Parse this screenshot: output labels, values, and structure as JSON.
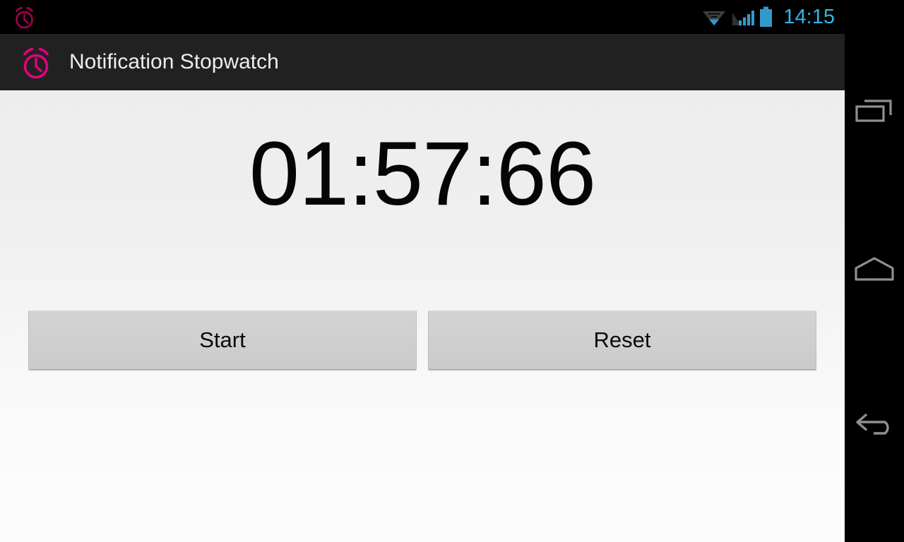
{
  "status_bar": {
    "alarm_icon": "alarm-clock-icon",
    "wifi_icon": "wifi-icon",
    "signal_icon": "cellular-signal-icon",
    "battery_icon": "battery-full-icon",
    "clock": "14:15",
    "accent_color": "#33b5e5",
    "background_color": "#000000"
  },
  "action_bar": {
    "app_icon": "alarm-clock-icon",
    "title": "Notification Stopwatch",
    "background_color": "#212121",
    "title_color": "#ededed",
    "icon_color": "#e6007e"
  },
  "main": {
    "timer": "01:57:66",
    "timer_color": "#050505",
    "background_top_color": "#ededee",
    "background_bottom_color": "#fcfcfc",
    "buttons": [
      {
        "label": "Start",
        "name": "start-button"
      },
      {
        "label": "Reset",
        "name": "reset-button"
      }
    ],
    "button_face_color": "#cfcfcf"
  },
  "nav_bar": {
    "background_color": "#000000",
    "icon_color": "#8f8f8f",
    "buttons": [
      {
        "name": "recents-button",
        "icon": "recents-icon"
      },
      {
        "name": "home-button",
        "icon": "home-icon"
      },
      {
        "name": "back-button",
        "icon": "back-arrow-icon"
      }
    ]
  }
}
